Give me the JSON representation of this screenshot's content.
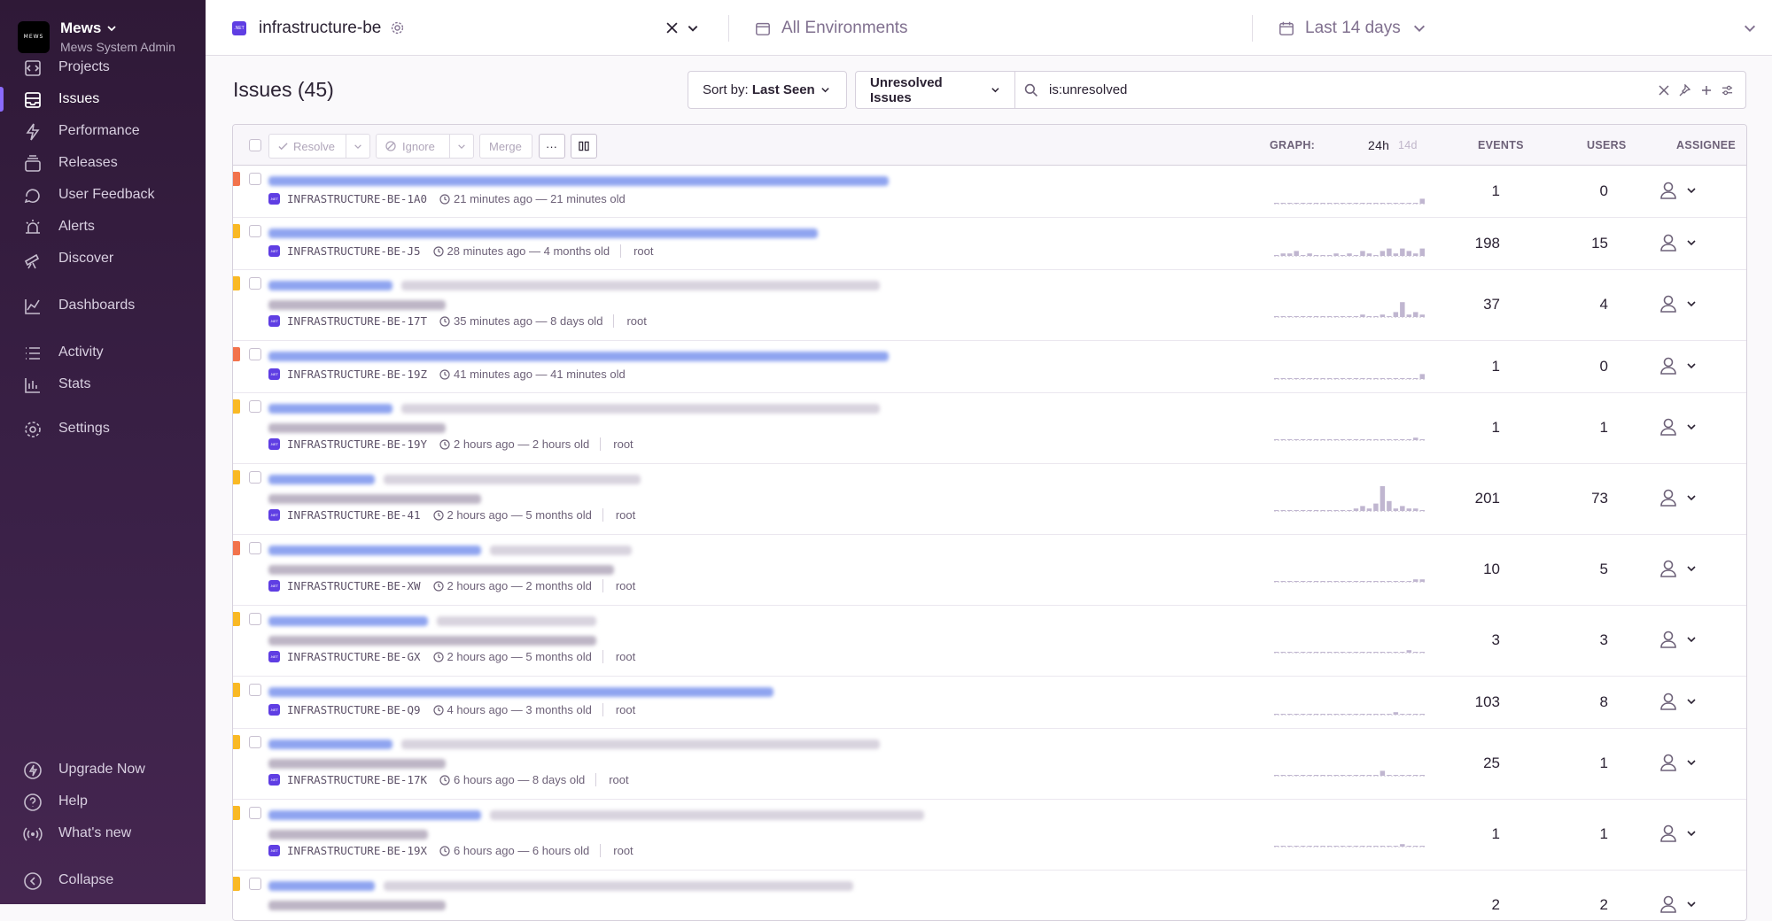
{
  "org": {
    "logo_text": "MEWS",
    "name": "Mews",
    "subtitle": "Mews System Admin"
  },
  "nav": {
    "items": [
      {
        "label": "Projects",
        "icon": "projects-icon"
      },
      {
        "label": "Issues",
        "icon": "issues-icon",
        "active": true
      },
      {
        "label": "Performance",
        "icon": "lightning-icon"
      },
      {
        "label": "Releases",
        "icon": "releases-icon"
      },
      {
        "label": "User Feedback",
        "icon": "feedback-icon"
      },
      {
        "label": "Alerts",
        "icon": "siren-icon"
      },
      {
        "label": "Discover",
        "icon": "telescope-icon"
      },
      {
        "label": "Dashboards",
        "icon": "graph-icon"
      },
      {
        "label": "Activity",
        "icon": "list-icon"
      },
      {
        "label": "Stats",
        "icon": "stats-icon"
      },
      {
        "label": "Settings",
        "icon": "gear-icon"
      }
    ],
    "footer": [
      {
        "label": "Upgrade Now",
        "icon": "lightning-circle-icon"
      },
      {
        "label": "Help",
        "icon": "question-icon"
      },
      {
        "label": "What's new",
        "icon": "broadcast-icon"
      },
      {
        "label": "Collapse",
        "icon": "collapse-icon"
      }
    ]
  },
  "topbar": {
    "project": "infrastructure-be",
    "platform_badge": ".NET",
    "environment": "All Environments",
    "date_range": "Last 14 days"
  },
  "issues": {
    "title": "Issues (45)",
    "sort_label": "Sort by:",
    "sort_value": "Last Seen",
    "saved_search": "Unresolved Issues",
    "query": "is:unresolved",
    "actions": {
      "resolve": "Resolve",
      "ignore": "Ignore",
      "merge": "Merge",
      "more": "···"
    },
    "columns": {
      "graph": "GRAPH:",
      "graph_24h": "24h",
      "graph_14d": "14d",
      "events": "EVENTS",
      "users": "USERS",
      "assignee": "ASSIGNEE"
    },
    "rows": [
      {
        "short_id": "INFRASTRUCTURE-BE-1A0",
        "time": "21 minutes ago — 21 minutes old",
        "culprit": "",
        "events": "1",
        "users": "0",
        "level_color": "#f2734c",
        "two_line": false,
        "spark": [
          0,
          0,
          0,
          0,
          0,
          0,
          0,
          0,
          0,
          0,
          0,
          0,
          0,
          0,
          0,
          0,
          0,
          0,
          0,
          0,
          0,
          0,
          2
        ]
      },
      {
        "short_id": "INFRASTRUCTURE-BE-J5",
        "time": "28 minutes ago — 4 months old",
        "culprit": "root",
        "events": "198",
        "users": "15",
        "level_color": "#f9b925",
        "two_line": false,
        "spark": [
          0,
          1,
          1,
          2,
          0,
          1,
          0,
          0,
          0,
          1,
          0,
          1,
          0,
          2,
          1,
          0,
          2,
          3,
          1,
          3,
          2,
          1,
          3
        ]
      },
      {
        "short_id": "INFRASTRUCTURE-BE-17T",
        "time": "35 minutes ago — 8 days old",
        "culprit": "root",
        "events": "37",
        "users": "4",
        "level_color": "#f9b925",
        "two_line": true,
        "spark": [
          0,
          0,
          0,
          0,
          0,
          0,
          0,
          0,
          0,
          0,
          0,
          0,
          0,
          1,
          0,
          0,
          1,
          0,
          2,
          6,
          1,
          2,
          1
        ]
      },
      {
        "short_id": "INFRASTRUCTURE-BE-19Z",
        "time": "41 minutes ago — 41 minutes old",
        "culprit": "",
        "events": "1",
        "users": "0",
        "level_color": "#f2734c",
        "two_line": false,
        "spark": [
          0,
          0,
          0,
          0,
          0,
          0,
          0,
          0,
          0,
          0,
          0,
          0,
          0,
          0,
          0,
          0,
          0,
          0,
          0,
          0,
          0,
          0,
          2
        ]
      },
      {
        "short_id": "INFRASTRUCTURE-BE-19Y",
        "time": "2 hours ago — 2 hours old",
        "culprit": "root",
        "events": "1",
        "users": "1",
        "level_color": "#f9b925",
        "two_line": true,
        "spark": [
          0,
          0,
          0,
          0,
          0,
          0,
          0,
          0,
          0,
          0,
          0,
          0,
          0,
          0,
          0,
          0,
          0,
          0,
          0,
          0,
          0,
          1,
          0
        ]
      },
      {
        "short_id": "INFRASTRUCTURE-BE-41",
        "time": "2 hours ago — 5 months old",
        "culprit": "root",
        "events": "201",
        "users": "73",
        "level_color": "#f9b925",
        "two_line": true,
        "spark": [
          0,
          0,
          0,
          0,
          0,
          0,
          0,
          0,
          0,
          0,
          0,
          0,
          1,
          2,
          1,
          3,
          10,
          4,
          1,
          2,
          1,
          1,
          0
        ]
      },
      {
        "short_id": "INFRASTRUCTURE-BE-XW",
        "time": "2 hours ago — 2 months old",
        "culprit": "root",
        "events": "10",
        "users": "5",
        "level_color": "#f2734c",
        "two_line": true,
        "spark": [
          0,
          0,
          0,
          0,
          0,
          0,
          0,
          0,
          0,
          0,
          0,
          0,
          0,
          0,
          0,
          0,
          0,
          0,
          0,
          0,
          0,
          1,
          1
        ]
      },
      {
        "short_id": "INFRASTRUCTURE-BE-GX",
        "time": "2 hours ago — 5 months old",
        "culprit": "root",
        "events": "3",
        "users": "3",
        "level_color": "#f9b925",
        "two_line": true,
        "spark": [
          0,
          0,
          0,
          0,
          0,
          0,
          0,
          0,
          0,
          0,
          0,
          0,
          0,
          0,
          0,
          0,
          0,
          0,
          0,
          0,
          1,
          0,
          0
        ]
      },
      {
        "short_id": "INFRASTRUCTURE-BE-Q9",
        "time": "4 hours ago — 3 months old",
        "culprit": "root",
        "events": "103",
        "users": "8",
        "level_color": "#f9b925",
        "two_line": false,
        "spark": [
          0,
          0,
          0,
          0,
          0,
          0,
          0,
          0,
          0,
          0,
          0,
          0,
          0,
          0,
          0,
          0,
          0,
          0,
          1,
          0,
          0,
          0,
          0
        ]
      },
      {
        "short_id": "INFRASTRUCTURE-BE-17K",
        "time": "6 hours ago — 8 days old",
        "culprit": "root",
        "events": "25",
        "users": "1",
        "level_color": "#f9b925",
        "two_line": true,
        "spark": [
          0,
          0,
          0,
          0,
          0,
          0,
          0,
          0,
          0,
          0,
          0,
          0,
          0,
          0,
          0,
          0,
          2,
          0,
          0,
          0,
          0,
          0,
          0
        ]
      },
      {
        "short_id": "INFRASTRUCTURE-BE-19X",
        "time": "6 hours ago — 6 hours old",
        "culprit": "root",
        "events": "1",
        "users": "1",
        "level_color": "#f9b925",
        "two_line": true,
        "spark": [
          0,
          0,
          0,
          0,
          0,
          0,
          0,
          0,
          0,
          0,
          0,
          0,
          0,
          0,
          0,
          0,
          0,
          0,
          0,
          1,
          0,
          0,
          0
        ]
      },
      {
        "short_id": "",
        "time": "",
        "culprit": "",
        "events": "2",
        "users": "2",
        "level_color": "#f9b925",
        "two_line": true,
        "spark": []
      }
    ]
  },
  "colors": {
    "accent": "#6c5fc7",
    "link_blur": "#8fa4f0",
    "bar": "#c0b6d0"
  }
}
